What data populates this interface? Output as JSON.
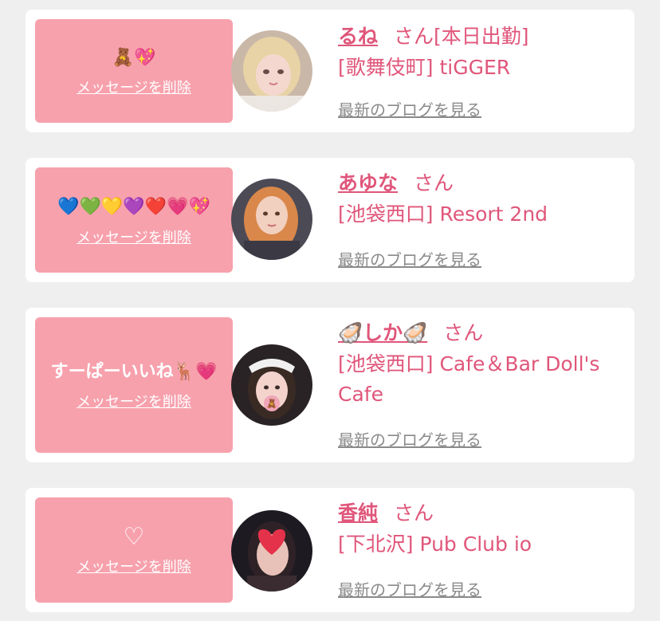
{
  "delete_label": "メッセージを削除",
  "blog_label": "最新のブログを見る",
  "san_label": "さん",
  "colors": {
    "bubble": "#f7a1ad",
    "accent": "#e0567a",
    "muted": "#8a8a8a"
  },
  "cards": [
    {
      "message": "🧸💖",
      "name": "るね",
      "san_suffix": "さん[本日出勤]",
      "shop": "[歌舞伎町] tiGGER",
      "avatar": "avatar-blonde-woman"
    },
    {
      "message": "💙💚💛💜❤️💗💖",
      "name": "あゆな",
      "san_suffix": "さん",
      "shop": "[池袋西口] Resort 2nd",
      "avatar": "avatar-orange-hair-woman"
    },
    {
      "message": "すーぱーいいね🦌💗",
      "name": "🦪しか🦪",
      "san_suffix": "さん",
      "shop": "[池袋西口] Cafe＆Bar Doll's Cafe",
      "avatar": "avatar-maid-woman"
    },
    {
      "message": "♡",
      "name": "香純",
      "san_suffix": "さん",
      "shop": "[下北沢] Pub Club io",
      "avatar": "avatar-heart-face-woman"
    }
  ]
}
